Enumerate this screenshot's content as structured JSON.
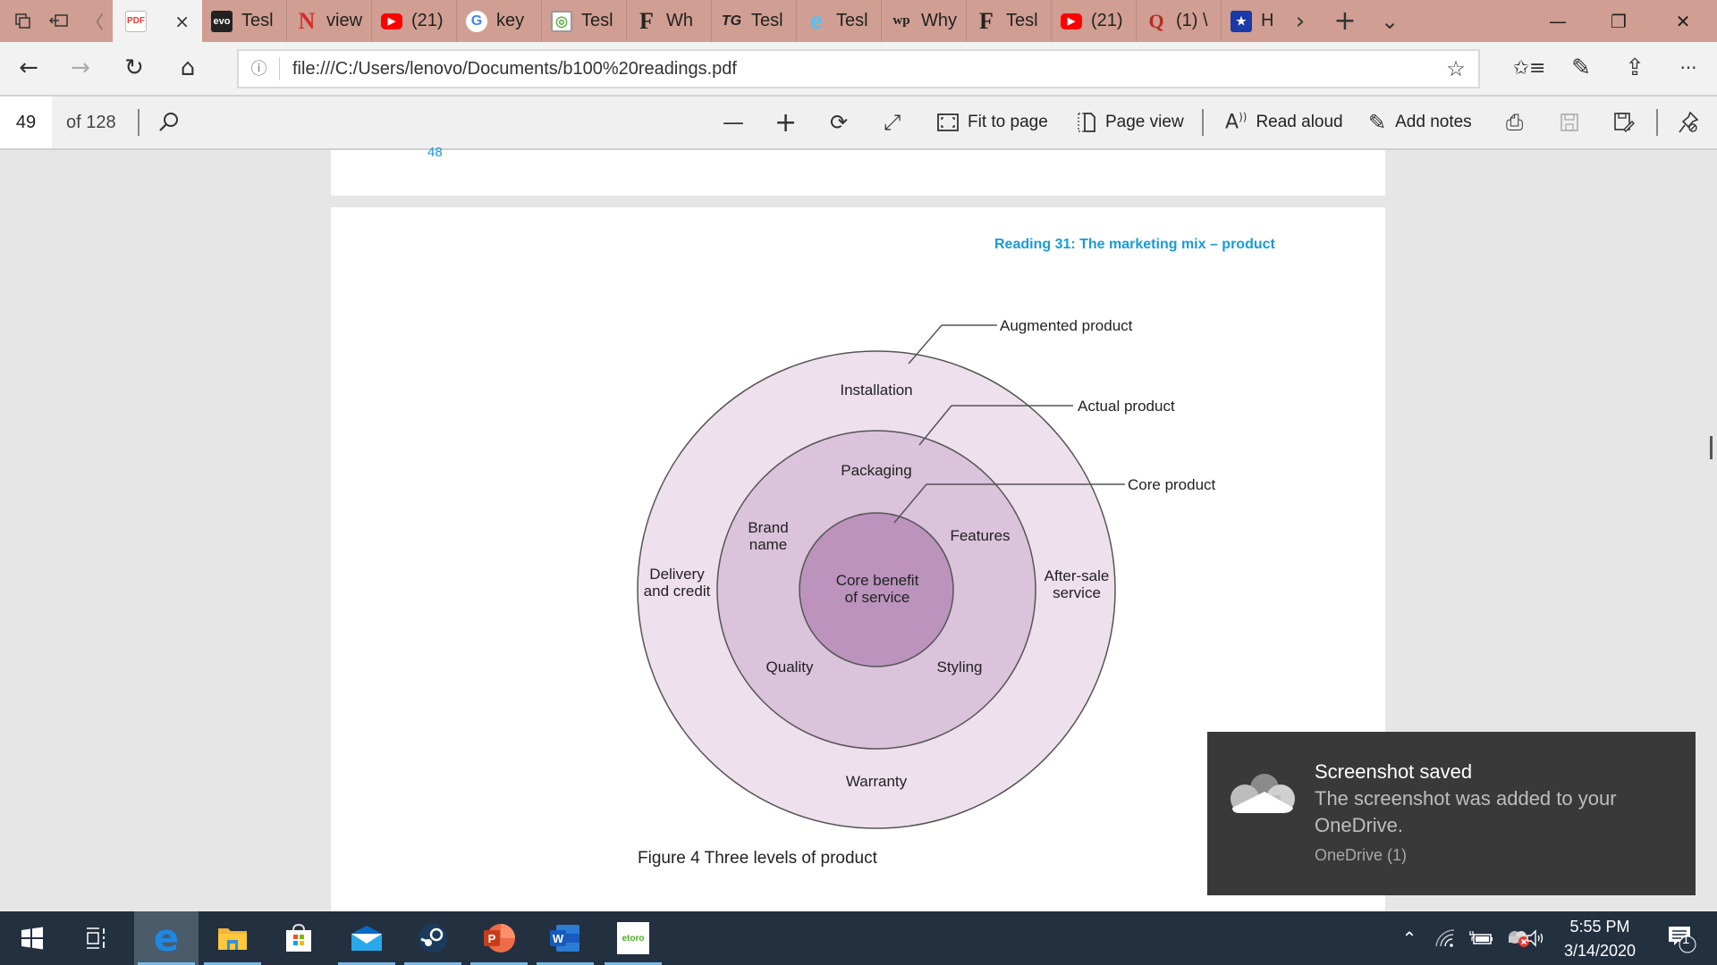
{
  "tabbar": {
    "active_tab": {
      "favicon": "pdf-icon",
      "favicon_text": "PDF",
      "close": "×"
    },
    "tabs": [
      {
        "favicon": "evo-icon",
        "favicon_text": "evo",
        "label": "Tesl"
      },
      {
        "favicon": "netflix-n-icon",
        "favicon_text": "N",
        "label": "view"
      },
      {
        "favicon": "youtube-icon",
        "favicon_text": "▶",
        "label": "(21)"
      },
      {
        "favicon": "google-icon",
        "favicon_text": "G",
        "label": "key"
      },
      {
        "favicon": "green-circle-icon",
        "favicon_text": "◎",
        "label": "Tesl"
      },
      {
        "favicon": "forbes-f-icon",
        "favicon_text": "F",
        "label": "Wh"
      },
      {
        "favicon": "tg-icon",
        "favicon_text": "TG",
        "label": "Tesl"
      },
      {
        "favicon": "edge-e-icon",
        "favicon_text": "e",
        "label": "Tesl"
      },
      {
        "favicon": "wp-icon",
        "favicon_text": "wp",
        "label": "Why"
      },
      {
        "favicon": "forbes-f-icon",
        "favicon_text": "F",
        "label": "Tesl"
      },
      {
        "favicon": "youtube-icon",
        "favicon_text": "▶",
        "label": "(21)"
      },
      {
        "favicon": "quora-q-icon",
        "favicon_text": "Q",
        "label": "(1) \\"
      },
      {
        "favicon": "shield-star-icon",
        "favicon_text": "★",
        "label": "H"
      }
    ],
    "scroll_right": "›",
    "new_tab": "+",
    "tab_list": "⌄",
    "minimize": "—",
    "restore": "❐",
    "close": "✕"
  },
  "navbar": {
    "back": "←",
    "forward": "→",
    "refresh": "↻",
    "home": "⌂",
    "info_icon": "ⓘ",
    "url": "file:///C:/Users/lenovo/Documents/b100%20readings.pdf",
    "favorite_star": "☆",
    "favorites": "✩≡",
    "notes": "✎",
    "share": "⇪",
    "more": "···"
  },
  "pdf_toolbar": {
    "page_number": "49",
    "page_count": "of 128",
    "search_icon": "⚲",
    "zoom_out": "—",
    "zoom_in": "+",
    "rotate": "⟳",
    "fullscreen": "⤢",
    "fit_to_page": "Fit to page",
    "page_view": "Page view",
    "read_aloud": "Read aloud",
    "add_notes": "Add notes",
    "print_icon": "⎙",
    "save_icon": "💾",
    "save_as_icon": "🖫",
    "pin_icon": "📌"
  },
  "document": {
    "prev_page_number": "48",
    "running_head": "Reading 31: The marketing mix – product",
    "figure_caption": "Figure 4 Three levels of product",
    "diagram": {
      "levels": [
        {
          "name": "Augmented product",
          "color": "#efe0ee"
        },
        {
          "name": "Actual product",
          "color": "#dbc3db"
        },
        {
          "name": "Core product",
          "color": "#bb93bd"
        }
      ],
      "core_label": [
        "Core benefit",
        "of service"
      ],
      "actual_items": {
        "top": "Packaging",
        "upper_left": [
          "Brand",
          "name"
        ],
        "upper_right": "Features",
        "lower_left": "Quality",
        "lower_right": "Styling"
      },
      "augmented_items": {
        "top": "Installation",
        "left": [
          "Delivery",
          "and credit"
        ],
        "right": [
          "After-sale",
          "service"
        ],
        "bottom": "Warranty"
      }
    }
  },
  "toast": {
    "title": "Screenshot saved",
    "message": "The screenshot was added to your OneDrive.",
    "source": "OneDrive (1)"
  },
  "taskbar": {
    "apps": [
      {
        "name": "start",
        "active": false
      },
      {
        "name": "task-view",
        "active": false
      },
      {
        "name": "edge",
        "active": true
      },
      {
        "name": "file-explorer",
        "active": false
      },
      {
        "name": "microsoft-store",
        "active": false
      },
      {
        "name": "mail",
        "active": false
      },
      {
        "name": "steam",
        "active": false
      },
      {
        "name": "powerpoint",
        "active": false
      },
      {
        "name": "word",
        "active": false
      },
      {
        "name": "etoro",
        "active": false
      }
    ],
    "etoro_text": "etoro",
    "tray": {
      "chevron": "⌃",
      "volume": "🔈",
      "time": "5:55 PM",
      "date": "3/14/2020",
      "notifications_count": "1"
    }
  }
}
